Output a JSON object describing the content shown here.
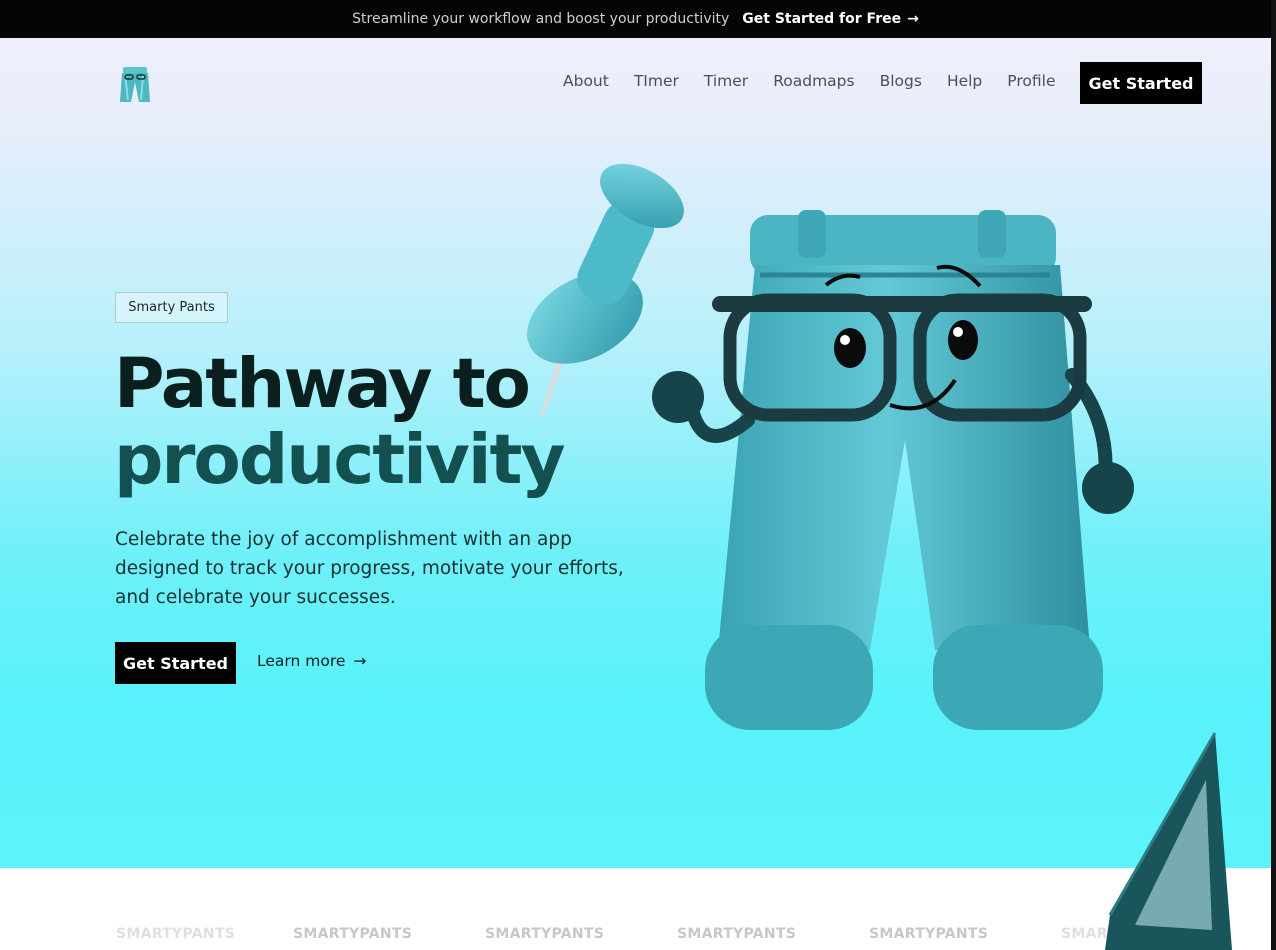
{
  "announcement": {
    "text": "Streamline your workflow and boost your productivity",
    "cta": "Get Started for Free",
    "arrow": "→"
  },
  "nav": {
    "items": [
      "About",
      "TImer",
      "Timer",
      "Roadmaps",
      "Blogs",
      "Help",
      "Profile"
    ],
    "cta": "Get Started"
  },
  "hero": {
    "badge": "Smarty Pants",
    "title_line1": "Pathway to",
    "title_line2": "productivity",
    "description": "Celebrate the joy of accomplishment with an app designed to track your progress, motivate your efforts, and celebrate your successes.",
    "cta": "Get Started",
    "learn_more": "Learn more",
    "learn_arrow": "→"
  },
  "marquee": {
    "words": [
      "SMARTYPANTS",
      "SMARTYPANTS",
      "SMARTYPANTS",
      "SMARTYPANTS",
      "SMARTYPANTS",
      "SMARTYPANTS"
    ]
  },
  "icons": [
    "arrow-right-icon",
    "pants-logo-icon",
    "pushpin-illustration",
    "pants-mascot-illustration",
    "set-square-illustration"
  ],
  "colors": {
    "black": "#000000",
    "heading_dark": "#0b1f1f",
    "heading_teal": "#155050",
    "aqua": "#5df3fa"
  }
}
